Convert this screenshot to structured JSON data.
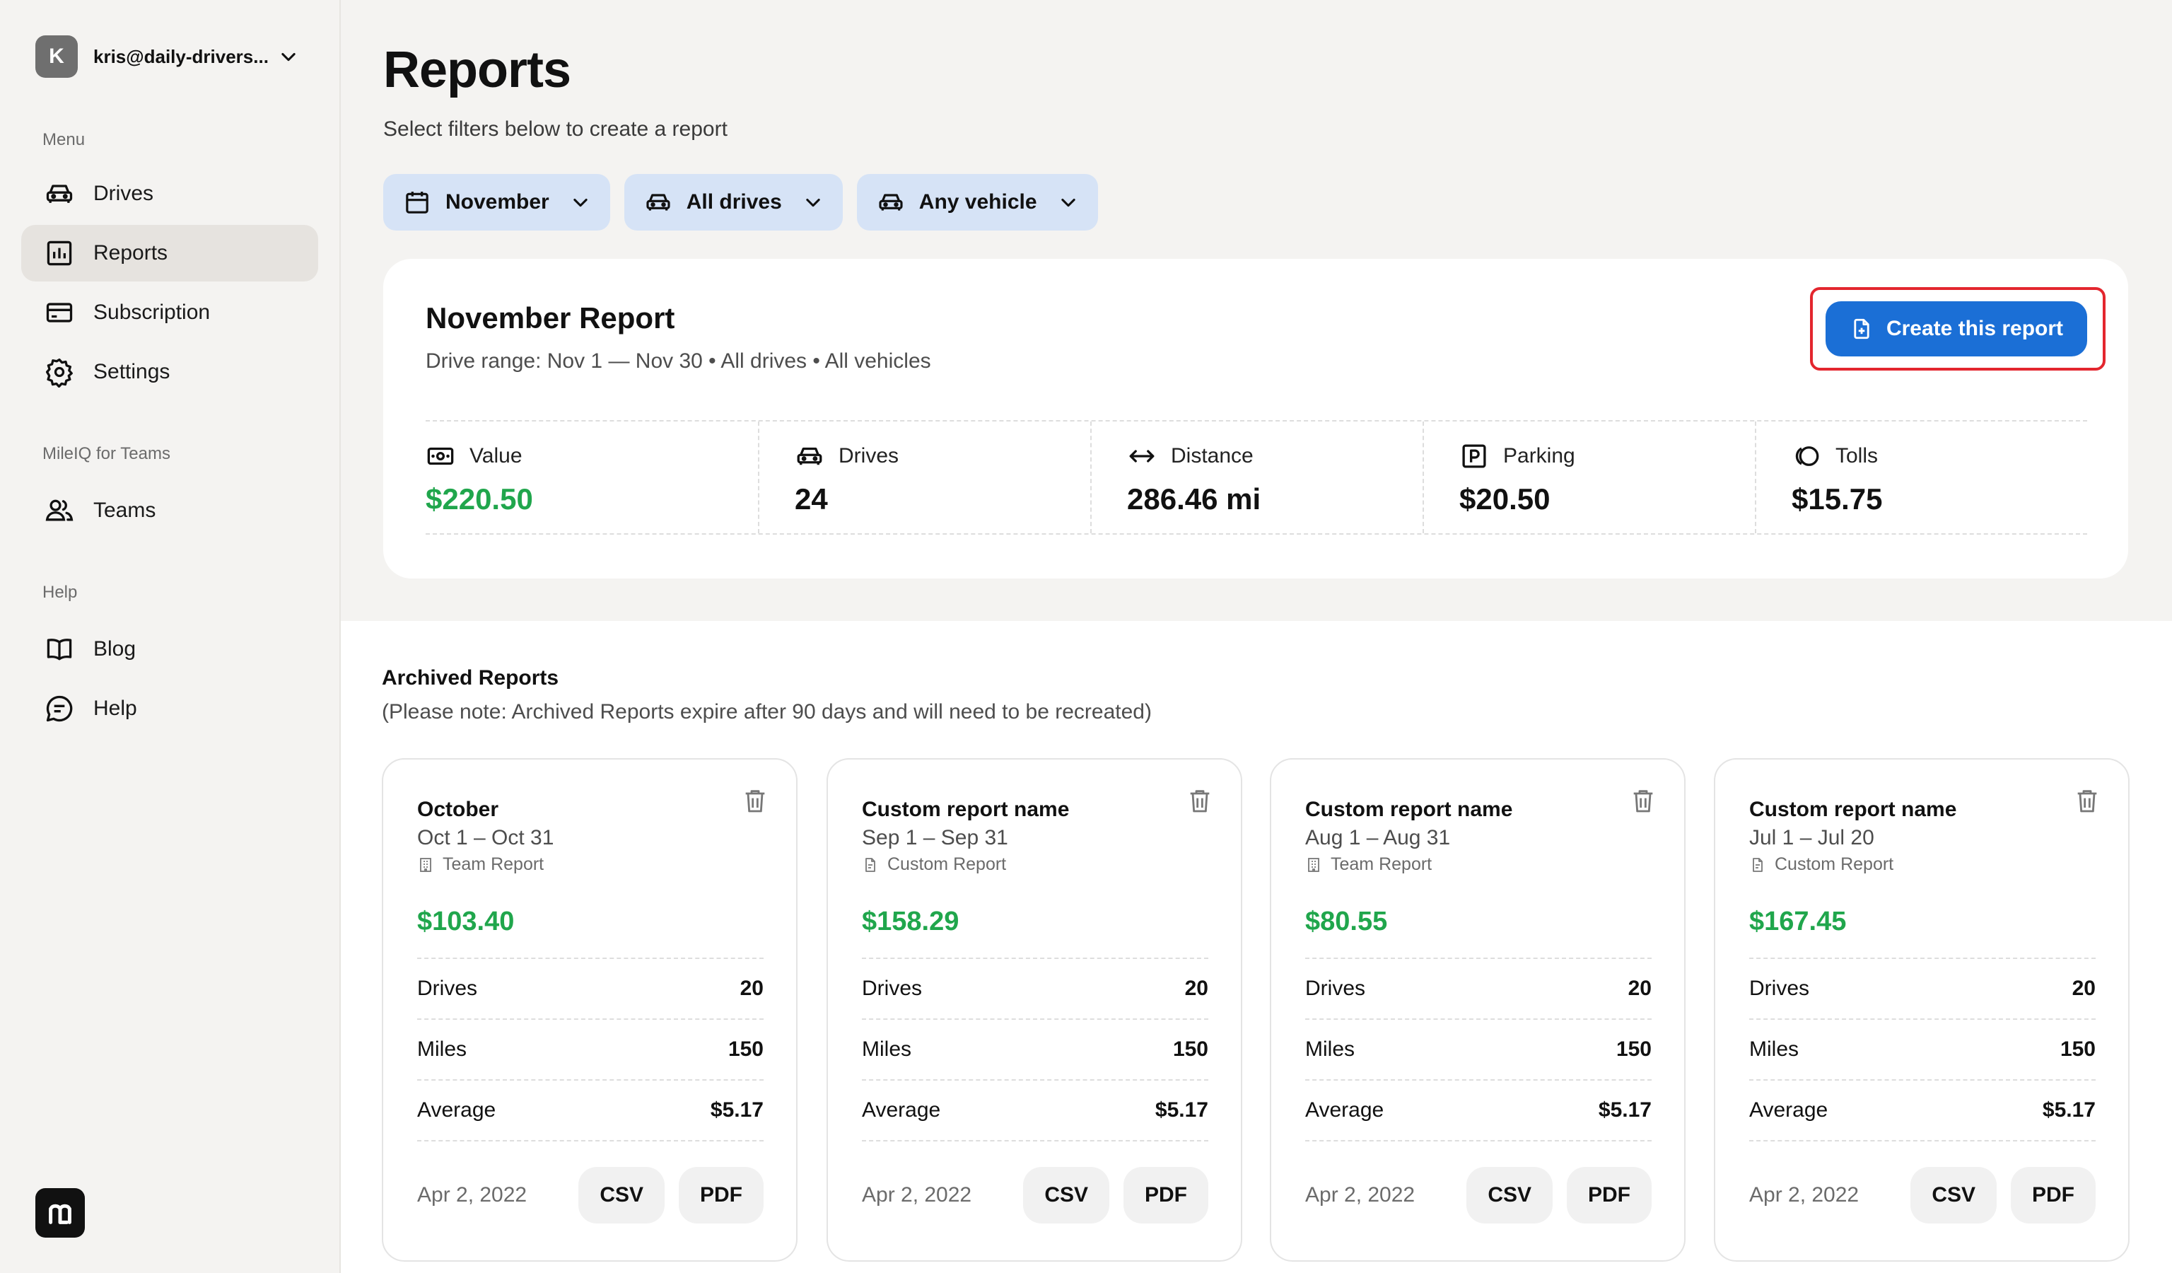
{
  "account": {
    "initial": "K",
    "email": "kris@daily-drivers..."
  },
  "sidebar": {
    "menu_label": "Menu",
    "menu_items": [
      {
        "label": "Drives",
        "icon": "car-icon"
      },
      {
        "label": "Reports",
        "icon": "reports-icon",
        "active": true
      },
      {
        "label": "Subscription",
        "icon": "card-icon"
      },
      {
        "label": "Settings",
        "icon": "gear-icon"
      }
    ],
    "teams_label": "MileIQ for Teams",
    "teams_items": [
      {
        "label": "Teams",
        "icon": "people-icon"
      }
    ],
    "help_label": "Help",
    "help_items": [
      {
        "label": "Blog",
        "icon": "book-icon"
      },
      {
        "label": "Help",
        "icon": "chat-icon"
      }
    ]
  },
  "header": {
    "title": "Reports",
    "subtitle": "Select filters below to create a report",
    "filters": [
      {
        "label": "November",
        "icon": "calendar-icon"
      },
      {
        "label": "All drives",
        "icon": "car-icon"
      },
      {
        "label": "Any vehicle",
        "icon": "car-icon"
      }
    ]
  },
  "report": {
    "title": "November Report",
    "meta": "Drive range: Nov 1 — Nov 30  •  All drives  •  All vehicles",
    "create_label": "Create this report",
    "stats": [
      {
        "label": "Value",
        "value": "$220.50",
        "icon": "money-icon",
        "green": true
      },
      {
        "label": "Drives",
        "value": "24",
        "icon": "car-icon"
      },
      {
        "label": "Distance",
        "value": "286.46 mi",
        "icon": "arrows-icon"
      },
      {
        "label": "Parking",
        "value": "$20.50",
        "icon": "parking-icon"
      },
      {
        "label": "Tolls",
        "value": "$15.75",
        "icon": "tolls-icon"
      }
    ]
  },
  "archived": {
    "title": "Archived Reports",
    "note": "(Please note: Archived Reports expire after 90 days and will need to be recreated)",
    "row_labels": {
      "drives": "Drives",
      "miles": "Miles",
      "average": "Average"
    },
    "csv_label": "CSV",
    "pdf_label": "PDF",
    "cards": [
      {
        "name": "October",
        "range": "Oct 1 – Oct 31",
        "type": "Team Report",
        "value": "$103.40",
        "drives": "20",
        "miles": "150",
        "average": "$5.17",
        "date": "Apr 2, 2022"
      },
      {
        "name": "Custom report name",
        "range": "Sep 1 – Sep 31",
        "type": "Custom Report",
        "value": "$158.29",
        "drives": "20",
        "miles": "150",
        "average": "$5.17",
        "date": "Apr 2, 2022"
      },
      {
        "name": "Custom report name",
        "range": "Aug 1 – Aug 31",
        "type": "Team Report",
        "value": "$80.55",
        "drives": "20",
        "miles": "150",
        "average": "$5.17",
        "date": "Apr 2, 2022"
      },
      {
        "name": "Custom report name",
        "range": "Jul 1 – Jul 20",
        "type": "Custom Report",
        "value": "$167.45",
        "drives": "20",
        "miles": "150",
        "average": "$5.17",
        "date": "Apr 2, 2022"
      }
    ]
  },
  "colors": {
    "accent": "#1b6fd6",
    "money": "#20a64c",
    "highlight": "#e3262e",
    "filter_bg": "#d6e3f6"
  }
}
